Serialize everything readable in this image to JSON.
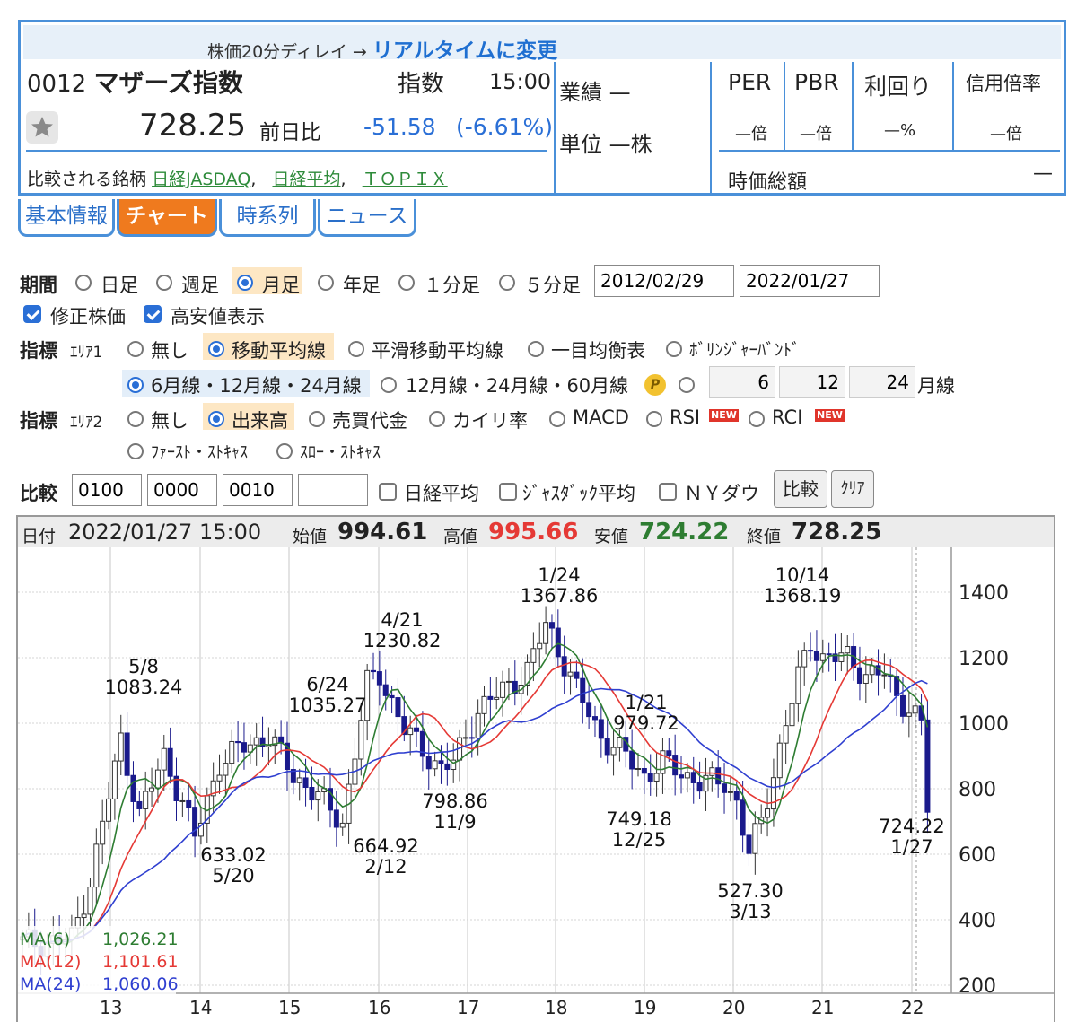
{
  "header": {
    "delay_text": "株価20分ディレイ → ",
    "realtime_link": "リアルタイムに変更",
    "code": "0012",
    "name": "マザーズ指数",
    "type_label": "指数",
    "time": "15:00",
    "price": "728.25",
    "prev_label": "前日比",
    "change": "-51.58",
    "change_pct": "(-6.61%)",
    "compare_label": "比較される銘柄",
    "compare_links": [
      "日経JASDAQ",
      "日経平均",
      "ＴＯＰＩＸ"
    ],
    "performance": "業績 —",
    "unit": "単位 —株",
    "per_label": "PER",
    "per_value": "—倍",
    "pbr_label": "PBR",
    "pbr_value": "—倍",
    "yield_label": "利回り",
    "yield_value": "—%",
    "margin_label": "信用倍率",
    "margin_value": "—倍",
    "mktcap_label": "時価総額",
    "mktcap_value": "—"
  },
  "tabs": [
    "基本情報",
    "チャート",
    "時系列",
    "ニュース"
  ],
  "form": {
    "period_label": "期間",
    "period_options": [
      "日足",
      "週足",
      "月足",
      "年足",
      "１分足",
      "５分足"
    ],
    "date_from": "2012/02/29",
    "date_to": "2022/01/27",
    "adjusted": "修正株価",
    "show_hilo": "高安値表示",
    "indicator_label": "指標",
    "area1": "ｴﾘｱ1",
    "area1_options": [
      "無し",
      "移動平均線",
      "平滑移動平均線",
      "一目均衡表",
      "ﾎﾞﾘﾝｼﾞｬｰﾊﾞﾝﾄﾞ"
    ],
    "ma_set1": "6月線・12月線・24月線",
    "ma_set2": "12月線・24月線・60月線",
    "p_badge": "P",
    "ma_custom": [
      "6",
      "12",
      "24"
    ],
    "ma_custom_unit": "月線",
    "area2": "ｴﾘｱ2",
    "area2_options": [
      "無し",
      "出来高",
      "売買代金",
      "カイリ率",
      "MACD",
      "RSI",
      "RCI"
    ],
    "new_badge": "NEW",
    "area2_options_row2": [
      "ﾌｧｰｽﾄ・ｽﾄｷｬｽ",
      "ｽﾛｰ・ｽﾄｷｬｽ"
    ],
    "compare_label": "比較",
    "compare_codes": [
      "0100",
      "0000",
      "0010",
      ""
    ],
    "compare_checks": [
      "日経平均",
      "ｼﾞｬｽﾀﾞｯｸ平均",
      "ＮＹダウ"
    ],
    "compare_button": "比較",
    "clear_button": "ｸﾘｱ"
  },
  "chart_info": {
    "date_label": "日付",
    "date": "2022/01/27 15:00",
    "open_label": "始値",
    "open": "994.61",
    "high_label": "高値",
    "high": "995.66",
    "low_label": "安値",
    "low": "724.22",
    "close_label": "終値",
    "close": "728.25"
  },
  "legend": [
    {
      "name": "MA(6)",
      "value": "1,026.21",
      "color": "#2e7d32"
    },
    {
      "name": "MA(12)",
      "value": "1,101.61",
      "color": "#e53935"
    },
    {
      "name": "MA(24)",
      "value": "1,060.06",
      "color": "#2f3fd0"
    }
  ],
  "chart_data": {
    "type": "candlestick",
    "x_ticks": [
      "13",
      "14",
      "15",
      "16",
      "17",
      "18",
      "19",
      "20",
      "21",
      "22"
    ],
    "y_ticks": [
      "1400",
      "1200",
      "1000",
      "800",
      "600",
      "400",
      "200"
    ],
    "ylim": [
      200,
      1450
    ],
    "annotations": [
      {
        "date": "5/8",
        "value": "1083.24"
      },
      {
        "date": "5/20",
        "value": "633.02"
      },
      {
        "date": "6/24",
        "value": "1035.27"
      },
      {
        "date": "2/12",
        "value": "664.92"
      },
      {
        "date": "4/21",
        "value": "1230.82"
      },
      {
        "date": "11/9",
        "value": "798.86"
      },
      {
        "date": "1/24",
        "value": "1367.86"
      },
      {
        "date": "12/25",
        "value": "749.18"
      },
      {
        "date": "1/21",
        "value": "979.72"
      },
      {
        "date": "3/13",
        "value": "527.30"
      },
      {
        "date": "10/14",
        "value": "1368.19"
      },
      {
        "date": "1/27",
        "value": "724.22"
      }
    ],
    "anchors": [
      [
        0,
        330
      ],
      [
        4,
        330
      ],
      [
        8,
        340
      ],
      [
        11,
        520
      ],
      [
        16,
        950
      ],
      [
        19,
        720
      ],
      [
        23,
        900
      ],
      [
        26,
        760
      ],
      [
        28,
        650
      ],
      [
        32,
        880
      ],
      [
        36,
        930
      ],
      [
        40,
        960
      ],
      [
        44,
        840
      ],
      [
        48,
        780
      ],
      [
        50,
        730
      ],
      [
        52,
        700
      ],
      [
        56,
        1120
      ],
      [
        58,
        1150
      ],
      [
        62,
        980
      ],
      [
        66,
        900
      ],
      [
        68,
        860
      ],
      [
        70,
        880
      ],
      [
        74,
        1040
      ],
      [
        78,
        1100
      ],
      [
        82,
        1160
      ],
      [
        85,
        1300
      ],
      [
        86,
        1270
      ],
      [
        90,
        1100
      ],
      [
        94,
        960
      ],
      [
        98,
        900
      ],
      [
        101,
        840
      ],
      [
        104,
        880
      ],
      [
        106,
        860
      ],
      [
        110,
        820
      ],
      [
        114,
        820
      ],
      [
        116,
        760
      ],
      [
        118,
        600
      ],
      [
        120,
        700
      ],
      [
        124,
        1000
      ],
      [
        126,
        1140
      ],
      [
        128,
        1250
      ],
      [
        130,
        1200
      ],
      [
        134,
        1200
      ],
      [
        137,
        1150
      ],
      [
        140,
        1150
      ],
      [
        142,
        1080
      ],
      [
        144,
        1050
      ],
      [
        146,
        995
      ],
      [
        147,
        728
      ]
    ]
  }
}
